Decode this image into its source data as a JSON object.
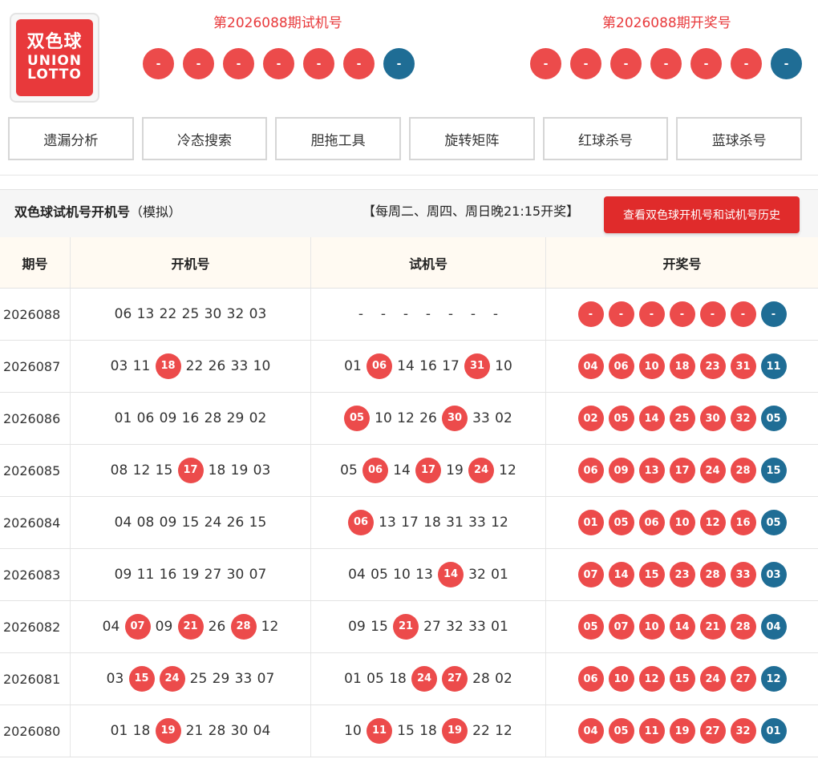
{
  "logo": {
    "text_zh": "双色球",
    "text_en": "UNION LOTTO"
  },
  "test_draw": {
    "title": "第2026088期试机号",
    "balls": [
      "-",
      "-",
      "-",
      "-",
      "-",
      "-",
      "-"
    ]
  },
  "open_draw": {
    "title": "第2026088期开奖号",
    "balls": [
      "-",
      "-",
      "-",
      "-",
      "-",
      "-",
      "-"
    ]
  },
  "tools": [
    "遗漏分析",
    "冷态搜索",
    "胆拖工具",
    "旋转矩阵",
    "红球杀号",
    "蓝球杀号"
  ],
  "section": {
    "title": "双色球试机号开机号",
    "title_suffix": "（模拟）",
    "schedule": "【每周二、周四、周日晚21:15开奖】",
    "history_button": "查看双色球开机号和试机号历史"
  },
  "table": {
    "headers": [
      "期号",
      "开机号",
      "试机号",
      "开奖号"
    ],
    "rows": [
      {
        "period": "2026088",
        "open": [
          "06",
          "13",
          "22",
          "25",
          "30",
          "32",
          "03"
        ],
        "open_hits": [],
        "test": [
          "-",
          "-",
          "-",
          "-",
          "-",
          "-",
          "-"
        ],
        "test_hits": [],
        "prize": [
          "-",
          "-",
          "-",
          "-",
          "-",
          "-",
          "-"
        ]
      },
      {
        "period": "2026087",
        "open": [
          "03",
          "11",
          "18",
          "22",
          "26",
          "33",
          "10"
        ],
        "open_hits": [
          2
        ],
        "test": [
          "01",
          "06",
          "14",
          "16",
          "17",
          "31",
          "10"
        ],
        "test_hits": [
          1,
          5
        ],
        "prize": [
          "04",
          "06",
          "10",
          "18",
          "23",
          "31",
          "11"
        ]
      },
      {
        "period": "2026086",
        "open": [
          "01",
          "06",
          "09",
          "16",
          "28",
          "29",
          "02"
        ],
        "open_hits": [],
        "test": [
          "05",
          "10",
          "12",
          "26",
          "30",
          "33",
          "02"
        ],
        "test_hits": [
          0,
          4
        ],
        "prize": [
          "02",
          "05",
          "14",
          "25",
          "30",
          "32",
          "05"
        ]
      },
      {
        "period": "2026085",
        "open": [
          "08",
          "12",
          "15",
          "17",
          "18",
          "19",
          "03"
        ],
        "open_hits": [
          3
        ],
        "test": [
          "05",
          "06",
          "14",
          "17",
          "19",
          "24",
          "12"
        ],
        "test_hits": [
          1,
          3,
          5
        ],
        "prize": [
          "06",
          "09",
          "13",
          "17",
          "24",
          "28",
          "15"
        ]
      },
      {
        "period": "2026084",
        "open": [
          "04",
          "08",
          "09",
          "15",
          "24",
          "26",
          "15"
        ],
        "open_hits": [],
        "test": [
          "06",
          "13",
          "17",
          "18",
          "31",
          "33",
          "12"
        ],
        "test_hits": [
          0
        ],
        "prize": [
          "01",
          "05",
          "06",
          "10",
          "12",
          "16",
          "05"
        ]
      },
      {
        "period": "2026083",
        "open": [
          "09",
          "11",
          "16",
          "19",
          "27",
          "30",
          "07"
        ],
        "open_hits": [],
        "test": [
          "04",
          "05",
          "10",
          "13",
          "14",
          "32",
          "01"
        ],
        "test_hits": [
          4
        ],
        "prize": [
          "07",
          "14",
          "15",
          "23",
          "28",
          "33",
          "03"
        ]
      },
      {
        "period": "2026082",
        "open": [
          "04",
          "07",
          "09",
          "21",
          "26",
          "28",
          "12"
        ],
        "open_hits": [
          1,
          3,
          5
        ],
        "test": [
          "09",
          "15",
          "21",
          "27",
          "32",
          "33",
          "01"
        ],
        "test_hits": [
          2
        ],
        "prize": [
          "05",
          "07",
          "10",
          "14",
          "21",
          "28",
          "04"
        ]
      },
      {
        "period": "2026081",
        "open": [
          "03",
          "15",
          "24",
          "25",
          "29",
          "33",
          "07"
        ],
        "open_hits": [
          1,
          2
        ],
        "test": [
          "01",
          "05",
          "18",
          "24",
          "27",
          "28",
          "02"
        ],
        "test_hits": [
          3,
          4
        ],
        "prize": [
          "06",
          "10",
          "12",
          "15",
          "24",
          "27",
          "12"
        ]
      },
      {
        "period": "2026080",
        "open": [
          "01",
          "18",
          "19",
          "21",
          "28",
          "30",
          "04"
        ],
        "open_hits": [
          2
        ],
        "test": [
          "10",
          "11",
          "15",
          "18",
          "19",
          "22",
          "12"
        ],
        "test_hits": [
          1,
          4
        ],
        "prize": [
          "04",
          "05",
          "11",
          "19",
          "27",
          "32",
          "01"
        ]
      }
    ]
  },
  "colors": {
    "red_ball": "#ec4b4b",
    "blue_ball": "#1f6d95",
    "accent": "#e02b2b"
  }
}
